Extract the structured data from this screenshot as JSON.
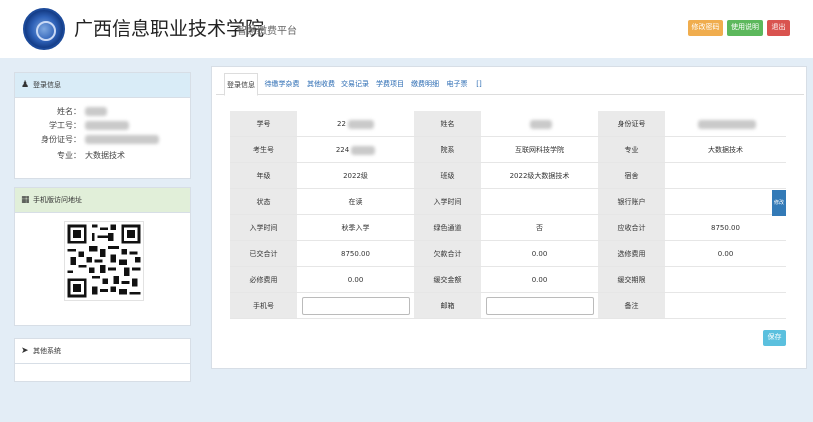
{
  "header": {
    "school_name": "广西信息职业技术学院",
    "platform_name": "智慧缴费平台",
    "buttons": {
      "change_password": "修改密码",
      "help": "使用说明",
      "logout": "退出"
    }
  },
  "sidebar": {
    "login_info": {
      "title": "登录信息",
      "rows": [
        {
          "label": "姓名：",
          "value": ""
        },
        {
          "label": "学工号：",
          "value": ""
        },
        {
          "label": "身份证号：",
          "value": ""
        },
        {
          "label": "专业：",
          "value": "大数据技术"
        }
      ]
    },
    "mobile": {
      "title": "手机版访问地址"
    },
    "other": {
      "title": "其他系统"
    }
  },
  "tabs": [
    "登录信息",
    "待缴学杂费",
    "其他收费",
    "交易记录",
    "学费项目",
    "缴费明细",
    "电子票",
    "[]"
  ],
  "table": {
    "rows": [
      [
        "学号",
        "22",
        "姓名",
        "",
        "身份证号",
        ""
      ],
      [
        "考生号",
        "224",
        "院系",
        "互联网科技学院",
        "专业",
        "大数据技术"
      ],
      [
        "年级",
        "2022级",
        "班级",
        "2022级大数据技术",
        "宿舍",
        ""
      ],
      [
        "状态",
        "在读",
        "入学时间",
        "",
        "银行账户",
        ""
      ],
      [
        "入学时间",
        "秋季入学",
        "绿色通道",
        "否",
        "应收合计",
        "8750.00"
      ],
      [
        "已交合计",
        "8750.00",
        "欠款合计",
        "0.00",
        "选修费用",
        "0.00"
      ],
      [
        "必修费用",
        "0.00",
        "缓交金额",
        "0.00",
        "缓交期限",
        ""
      ],
      [
        "手机号",
        "",
        "邮箱",
        "",
        "备注",
        ""
      ]
    ]
  },
  "actions": {
    "edit": "修改",
    "save": "保存"
  },
  "colors": {
    "edit_button": "#337ab7",
    "save_button": "#5bc0de",
    "page_bg": "#e3edf6"
  }
}
